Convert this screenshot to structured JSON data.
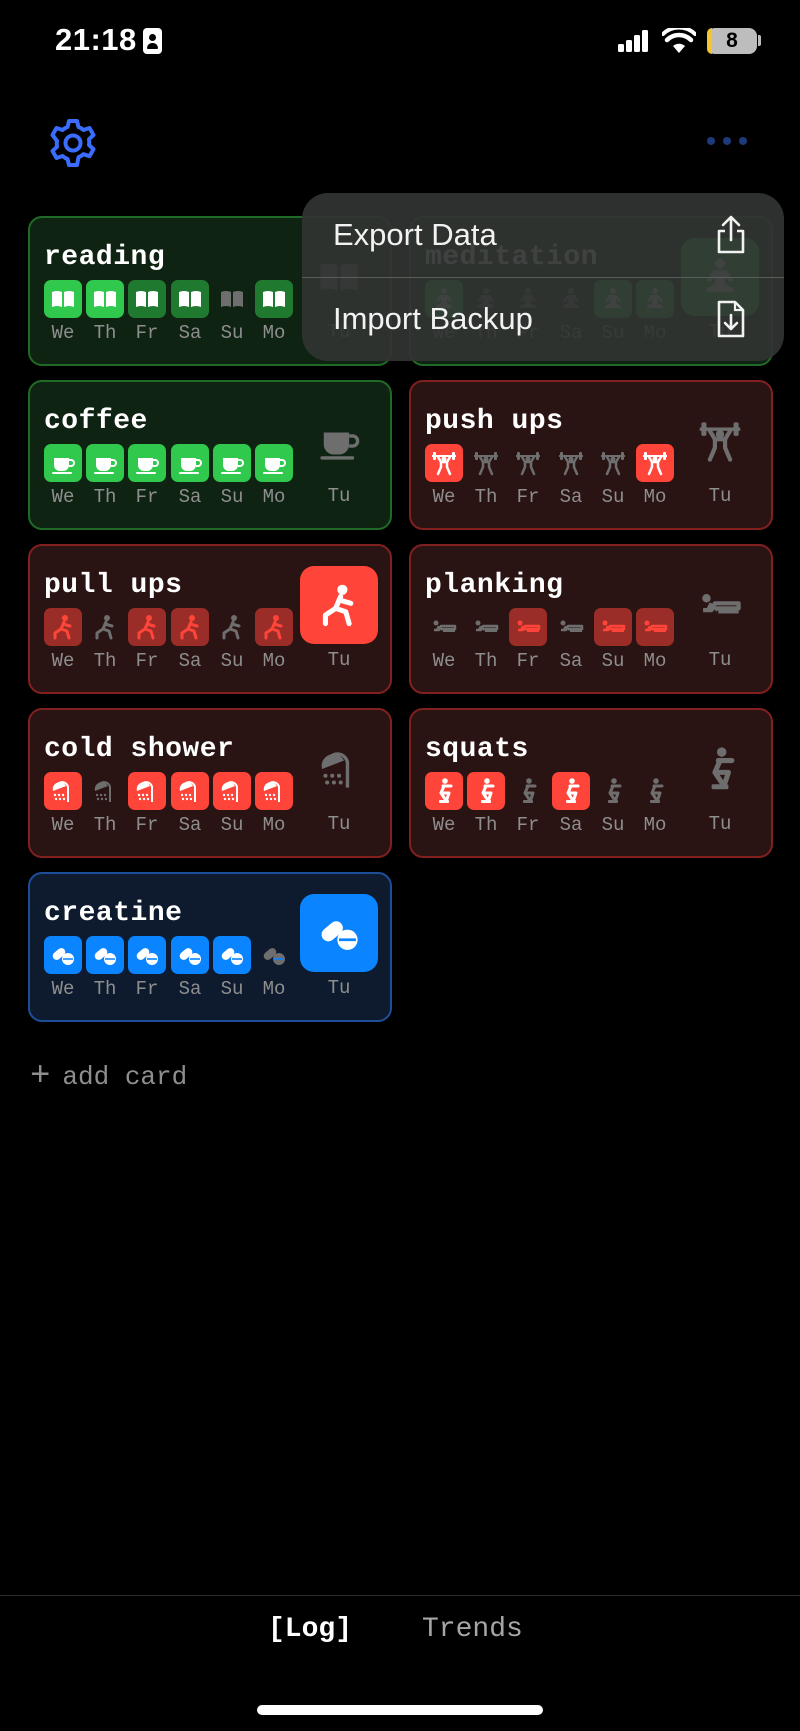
{
  "status_bar": {
    "time": "21:18",
    "battery": "8"
  },
  "menu": {
    "items": [
      {
        "label": "Export Data",
        "icon": "share-icon"
      },
      {
        "label": "Import Backup",
        "icon": "doc-download-icon"
      }
    ]
  },
  "days": [
    "We",
    "Th",
    "Fr",
    "Sa",
    "Su",
    "Mo"
  ],
  "today_label": "Tu",
  "colors": {
    "green": "#30c94e",
    "green_dim": "#1f7a30",
    "red": "#ff453a",
    "red_dim": "#9a2d27",
    "blue": "#0a84ff",
    "inactive_icon": "#6e6e6e"
  },
  "cards": [
    {
      "title": "reading",
      "theme": "green",
      "icon": "book-icon",
      "days": [
        2,
        2,
        1,
        1,
        0,
        1
      ],
      "today": 0
    },
    {
      "title": "meditation",
      "theme": "green",
      "icon": "meditation-icon",
      "days": [
        2,
        0,
        0,
        0,
        2,
        2
      ],
      "today": 2
    },
    {
      "title": "coffee",
      "theme": "green",
      "icon": "coffee-icon",
      "days": [
        2,
        2,
        2,
        2,
        2,
        2
      ],
      "today": 0
    },
    {
      "title": "push ups",
      "theme": "red",
      "icon": "weightlift-icon",
      "days": [
        2,
        0,
        0,
        0,
        0,
        2
      ],
      "today": 0
    },
    {
      "title": "pull ups",
      "theme": "red",
      "icon": "lunge-icon",
      "days": [
        1,
        0,
        1,
        1,
        0,
        1
      ],
      "today": 2
    },
    {
      "title": "planking",
      "theme": "red",
      "icon": "plank-icon",
      "days": [
        0,
        0,
        1,
        0,
        1,
        1
      ],
      "today": 0
    },
    {
      "title": "cold shower",
      "theme": "red",
      "icon": "shower-icon",
      "days": [
        2,
        0,
        2,
        2,
        2,
        2
      ],
      "today": 0
    },
    {
      "title": "squats",
      "theme": "red",
      "icon": "squat-icon",
      "days": [
        2,
        2,
        0,
        2,
        0,
        0
      ],
      "today": 0
    },
    {
      "title": "creatine",
      "theme": "blue",
      "icon": "pills-icon",
      "days": [
        2,
        2,
        2,
        2,
        2,
        0
      ],
      "today": 2
    }
  ],
  "add_card": {
    "label": "add card"
  },
  "tabs": {
    "log": "[Log]",
    "trends": "Trends"
  }
}
